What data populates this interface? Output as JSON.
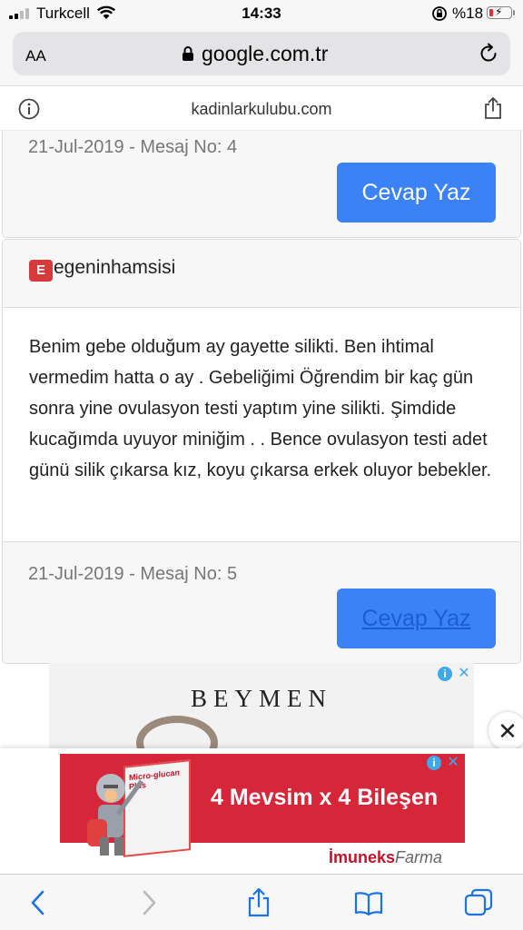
{
  "status_bar": {
    "carrier": "Turkcell",
    "time": "14:33",
    "battery": "%18"
  },
  "browser": {
    "text_size_label": "AA",
    "url": "google.com.tr",
    "site_domain": "kadinlarkulubu.com"
  },
  "posts": [
    {
      "meta": "21-Jul-2019 - Mesaj No: 4",
      "reply_label": "Cevap Yaz"
    },
    {
      "username": "egeninhamsisi",
      "avatar_letter": "E",
      "body": "Benim gebe olduğum ay gayette silikti. Ben ihtimal vermedim hatta o ay . Gebeliğimi Öğrendim bir kaç gün sonra yine ovulasyon testi yaptım yine silikti. Şimdide kucağımda uyuyor miniğim . . Bence ovulasyon testi adet günü silik çıkarsa kız, koyu çıkarsa erkek oluyor bebekler.",
      "meta": "21-Jul-2019 - Mesaj No: 5",
      "reply_label": "Cevap Yaz"
    }
  ],
  "ads": {
    "top_brand": "BEYMEN",
    "bottom_headline": "4 Mevsim x 4 Bileşen",
    "bottom_brand": "İmuneks",
    "bottom_brand_suffix": "Farma",
    "product_name": "Micro-glucan Plus"
  },
  "icons": {
    "info": "info-icon",
    "close": "close-icon",
    "back": "chevron-left-icon",
    "forward": "chevron-right-icon",
    "share": "share-icon",
    "bookmarks": "book-icon",
    "tabs": "tabs-icon",
    "reload": "reload-icon",
    "lock": "lock-icon"
  },
  "colors": {
    "reply_button": "#3b82f6",
    "avatar_badge": "#d63a3a",
    "ad_red": "#d6263a",
    "ios_blue": "#1a73e8"
  }
}
